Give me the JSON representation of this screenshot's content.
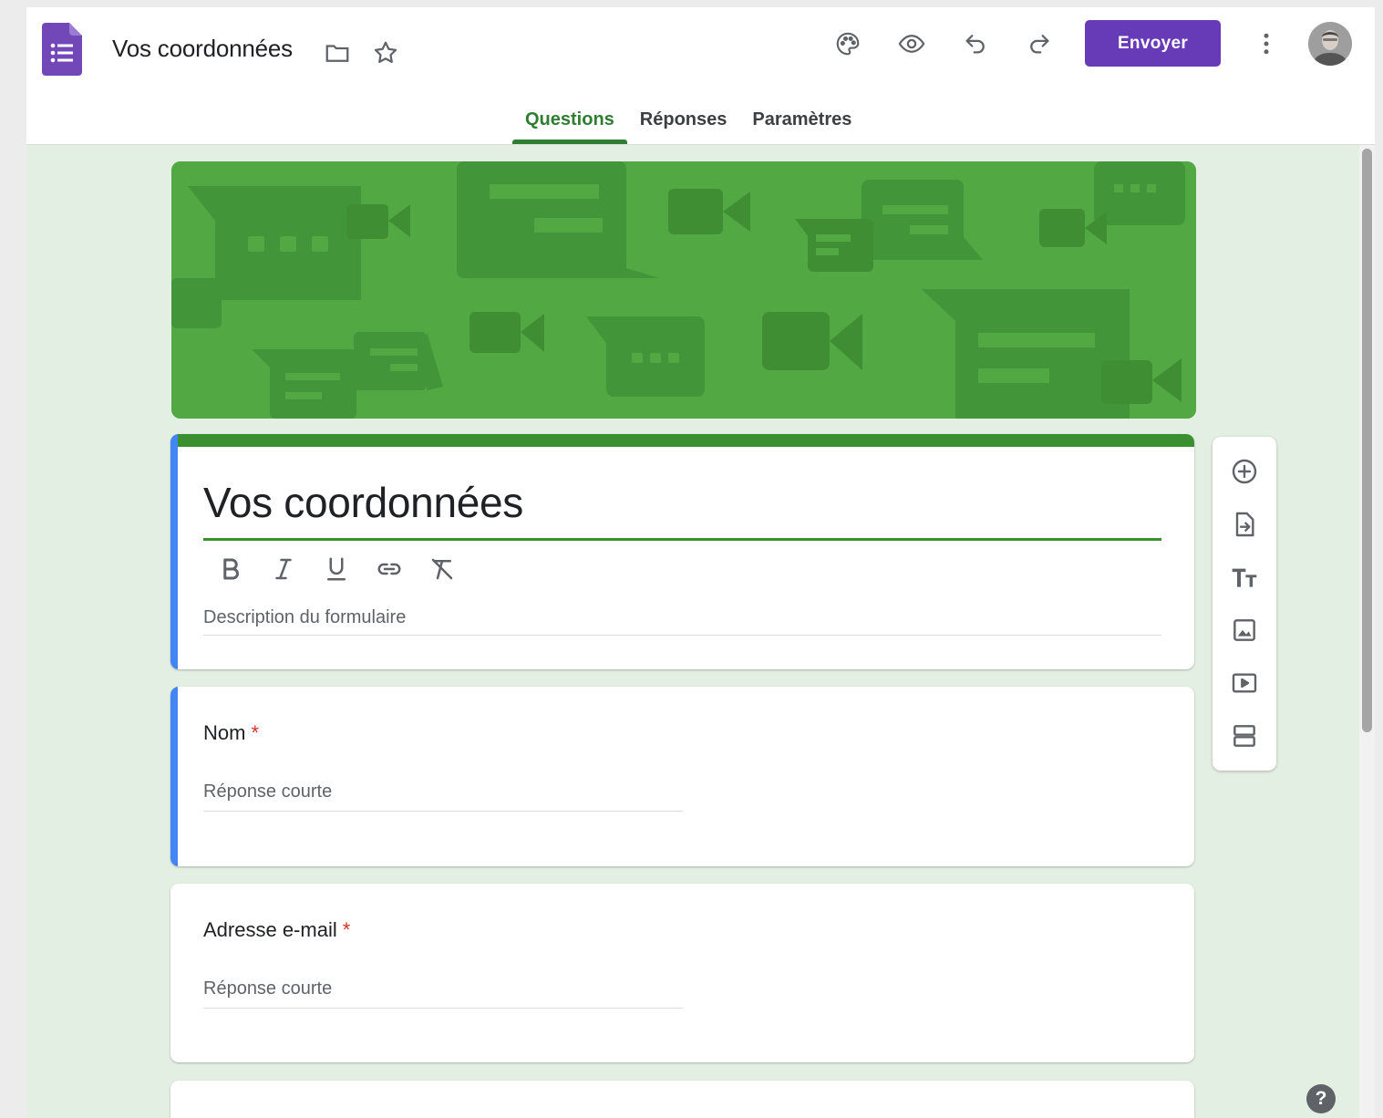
{
  "header": {
    "doc_title": "Vos coordonnées",
    "send_label": "Envoyer",
    "icons": [
      "forms-logo-icon",
      "folder-icon",
      "star-icon",
      "palette-icon",
      "eye-icon",
      "undo-icon",
      "redo-icon",
      "more-vert-icon"
    ]
  },
  "tabs": [
    {
      "label": "Questions",
      "active": true
    },
    {
      "label": "Réponses",
      "active": false
    },
    {
      "label": "Paramètres",
      "active": false
    }
  ],
  "form": {
    "title": "Vos coordonnées",
    "description_placeholder": "Description du formulaire",
    "format_icons": [
      "bold-icon",
      "italic-icon",
      "underline-icon",
      "link-icon",
      "clear-format-icon"
    ]
  },
  "questions": [
    {
      "label": "Nom",
      "required_mark": "*",
      "answer_placeholder": "Réponse courte"
    },
    {
      "label": "Adresse e-mail",
      "required_mark": "*",
      "answer_placeholder": "Réponse courte"
    }
  ],
  "side_toolbar": [
    "add-question-icon",
    "import-questions-icon",
    "add-title-icon",
    "add-image-icon",
    "add-video-icon",
    "add-section-icon"
  ],
  "help_label": "?",
  "colors": {
    "accent_purple": "#673ab7",
    "theme_green": "#3a8f2f",
    "focus_blue": "#4285f4",
    "background": "#e4efe3",
    "required_red": "#d93025"
  }
}
